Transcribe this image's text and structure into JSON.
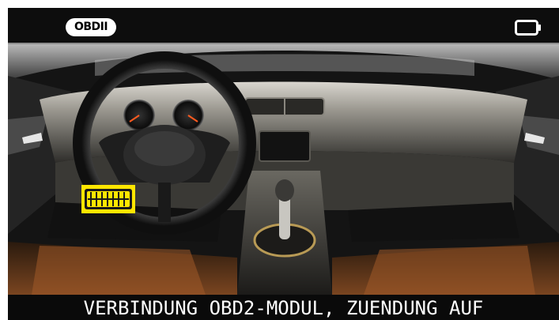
{
  "status_bar": {
    "mode_badge": "OBDII",
    "battery_icon": "battery-icon"
  },
  "scene": {
    "image": "car-interior-dashboard",
    "highlight_icon": "obd-port-icon",
    "highlight_color": "#ffe600"
  },
  "message": {
    "text": "VERBINDUNG OBD2-MODUL, ZUENDUNG AUF"
  }
}
